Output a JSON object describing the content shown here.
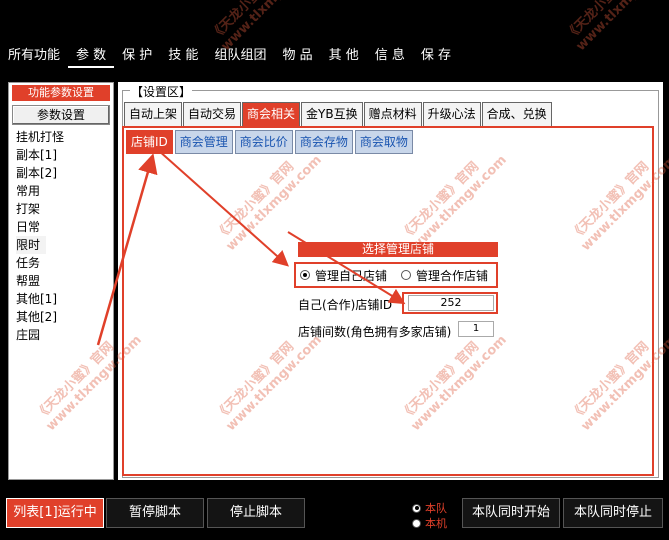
{
  "top_menu": {
    "items": [
      "所有功能",
      "参 数",
      "保 护",
      "技 能",
      "组队组团",
      "物 品",
      "其 他",
      "信 息",
      "保 存"
    ],
    "active_index": 1
  },
  "left_panel": {
    "title": "功能参数设置",
    "button": "参数设置",
    "items": [
      "挂机打怪",
      "副本[1]",
      "副本[2]",
      "常用",
      "打架",
      "日常",
      "限时",
      "任务",
      "帮盟",
      "其他[1]",
      "其他[2]",
      "庄园"
    ],
    "selected_index": 6
  },
  "settings": {
    "title": "【设置区】",
    "tabs": [
      "自动上架",
      "自动交易",
      "商会相关",
      "金YB互换",
      "赠点材料",
      "升级心法",
      "合成、兑换"
    ],
    "active_tab": 2,
    "subtabs": [
      "店铺ID",
      "商会管理",
      "商会比价",
      "商会存物",
      "商会取物"
    ],
    "active_subtab": 0
  },
  "shop_panel": {
    "group_title": "选择管理店铺",
    "radio_own": "管理自己店铺",
    "radio_coop": "管理合作店铺",
    "radio_selected": "own",
    "id_label": "自己(合作)店铺ID",
    "id_value": "252",
    "count_label": "店铺间数(角色拥有多家店铺)",
    "count_value": "1"
  },
  "bottom": {
    "run_button": "列表[1]运行中",
    "pause_button": "暂停脚本",
    "stop_button": "停止脚本",
    "radio_team": "本队",
    "radio_machine": "本机",
    "radio_selected": "team",
    "start_all_button": "本队同时开始",
    "stop_all_button": "本队同时停止"
  },
  "watermark": {
    "text": "《天龙小蜜》官网",
    "url": "www.tlxmgw.com"
  },
  "colors": {
    "accent": "#e0402a",
    "subtab_text": "#1a55b0",
    "subtab_bg": "#c8d6ea",
    "background": "#000000"
  }
}
